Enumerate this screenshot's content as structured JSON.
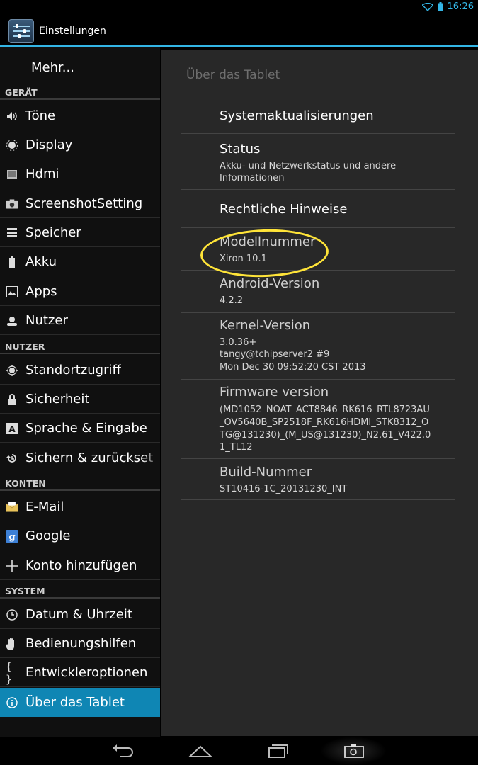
{
  "status_bar": {
    "time": "16:26"
  },
  "action_bar": {
    "title": "Einstellungen"
  },
  "sidebar": {
    "top_item": "Mehr...",
    "sections": [
      {
        "header": "GERÄT",
        "items": [
          {
            "label": "Töne",
            "icon": "speaker-icon"
          },
          {
            "label": "Display",
            "icon": "brightness-icon"
          },
          {
            "label": "Hdmi",
            "icon": "monitor-icon"
          },
          {
            "label": "ScreenshotSetting",
            "icon": "camera-icon"
          },
          {
            "label": "Speicher",
            "icon": "storage-icon"
          },
          {
            "label": "Akku",
            "icon": "battery-icon"
          },
          {
            "label": "Apps",
            "icon": "apps-icon"
          },
          {
            "label": "Nutzer",
            "icon": "user-icon"
          }
        ]
      },
      {
        "header": "NUTZER",
        "items": [
          {
            "label": "Standortzugriff",
            "icon": "location-icon"
          },
          {
            "label": "Sicherheit",
            "icon": "lock-icon"
          },
          {
            "label": "Sprache & Eingabe",
            "icon": "language-icon"
          },
          {
            "label": "Sichern & zurückset",
            "icon": "restore-icon"
          }
        ]
      },
      {
        "header": "KONTEN",
        "items": [
          {
            "label": "E-Mail",
            "icon": "email-icon"
          },
          {
            "label": "Google",
            "icon": "google-icon"
          },
          {
            "label": "Konto hinzufügen",
            "icon": "plus-icon"
          }
        ]
      },
      {
        "header": "SYSTEM",
        "items": [
          {
            "label": "Datum & Uhrzeit",
            "icon": "clock-icon"
          },
          {
            "label": "Bedienungshilfen",
            "icon": "hand-icon"
          },
          {
            "label": "Entwickleroptionen",
            "icon": "braces-icon"
          },
          {
            "label": "Über das Tablet",
            "icon": "info-icon"
          }
        ]
      }
    ]
  },
  "content": {
    "section_title": "Über das Tablet",
    "rows": [
      {
        "title": "Systemaktualisierungen"
      },
      {
        "title": "Status",
        "sub": "Akku- und Netzwerkstatus und andere Informationen"
      },
      {
        "title": "Rechtliche Hinweise"
      },
      {
        "title": "Modellnummer",
        "sub": "Xiron 10.1"
      },
      {
        "title": "Android-Version",
        "sub": "4.2.2"
      },
      {
        "title": "Kernel-Version",
        "sub1": "3.0.36+",
        "sub2": "tangy@tchipserver2 #9",
        "sub3": "Mon Dec 30 09:52:20 CST 2013"
      },
      {
        "title": "Firmware version",
        "sub1": "(MD1052_NOAT_ACT8846_RK616_RTL8723AU",
        "sub2": "_OV5640B_SP2518F_RK616HDMI_STK8312_O",
        "sub3": "TG@131230)_(M_US@131230)_N2.61_V422.0",
        "sub4": "1_TL12"
      },
      {
        "title": "Build-Nummer",
        "sub": "ST10416-1C_20131230_INT"
      }
    ]
  },
  "colors": {
    "accent": "#33b5e5",
    "selected": "#0f86b4",
    "annotation": "#ffe438"
  }
}
